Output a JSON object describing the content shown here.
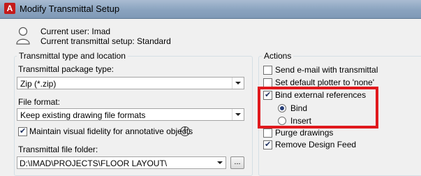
{
  "window": {
    "title": "Modify Transmittal Setup"
  },
  "user_info": {
    "current_user": "Current user: Imad",
    "current_setup": "Current transmittal setup: Standard"
  },
  "type_location": {
    "group_label": "Transmittal type and location",
    "package_type_label": "Transmittal package type:",
    "package_type_value": "Zip (*.zip)",
    "file_format_label": "File format:",
    "file_format_value": "Keep existing drawing file formats",
    "visual_fidelity_label": "Maintain visual fidelity for annotative objects",
    "folder_label": "Transmittal file folder:",
    "folder_value": "D:\\IMAD\\PROJECTS\\FLOOR LAYOUT\\",
    "browse_label": "..."
  },
  "actions": {
    "group_label": "Actions",
    "send_email": "Send e-mail with transmittal",
    "default_plotter": "Set default plotter to 'none'",
    "bind_xrefs": "Bind external references",
    "bind_option": "Bind",
    "insert_option": "Insert",
    "purge": "Purge drawings",
    "remove_design_feed": "Remove Design Feed"
  },
  "app_icon_letter": "A"
}
